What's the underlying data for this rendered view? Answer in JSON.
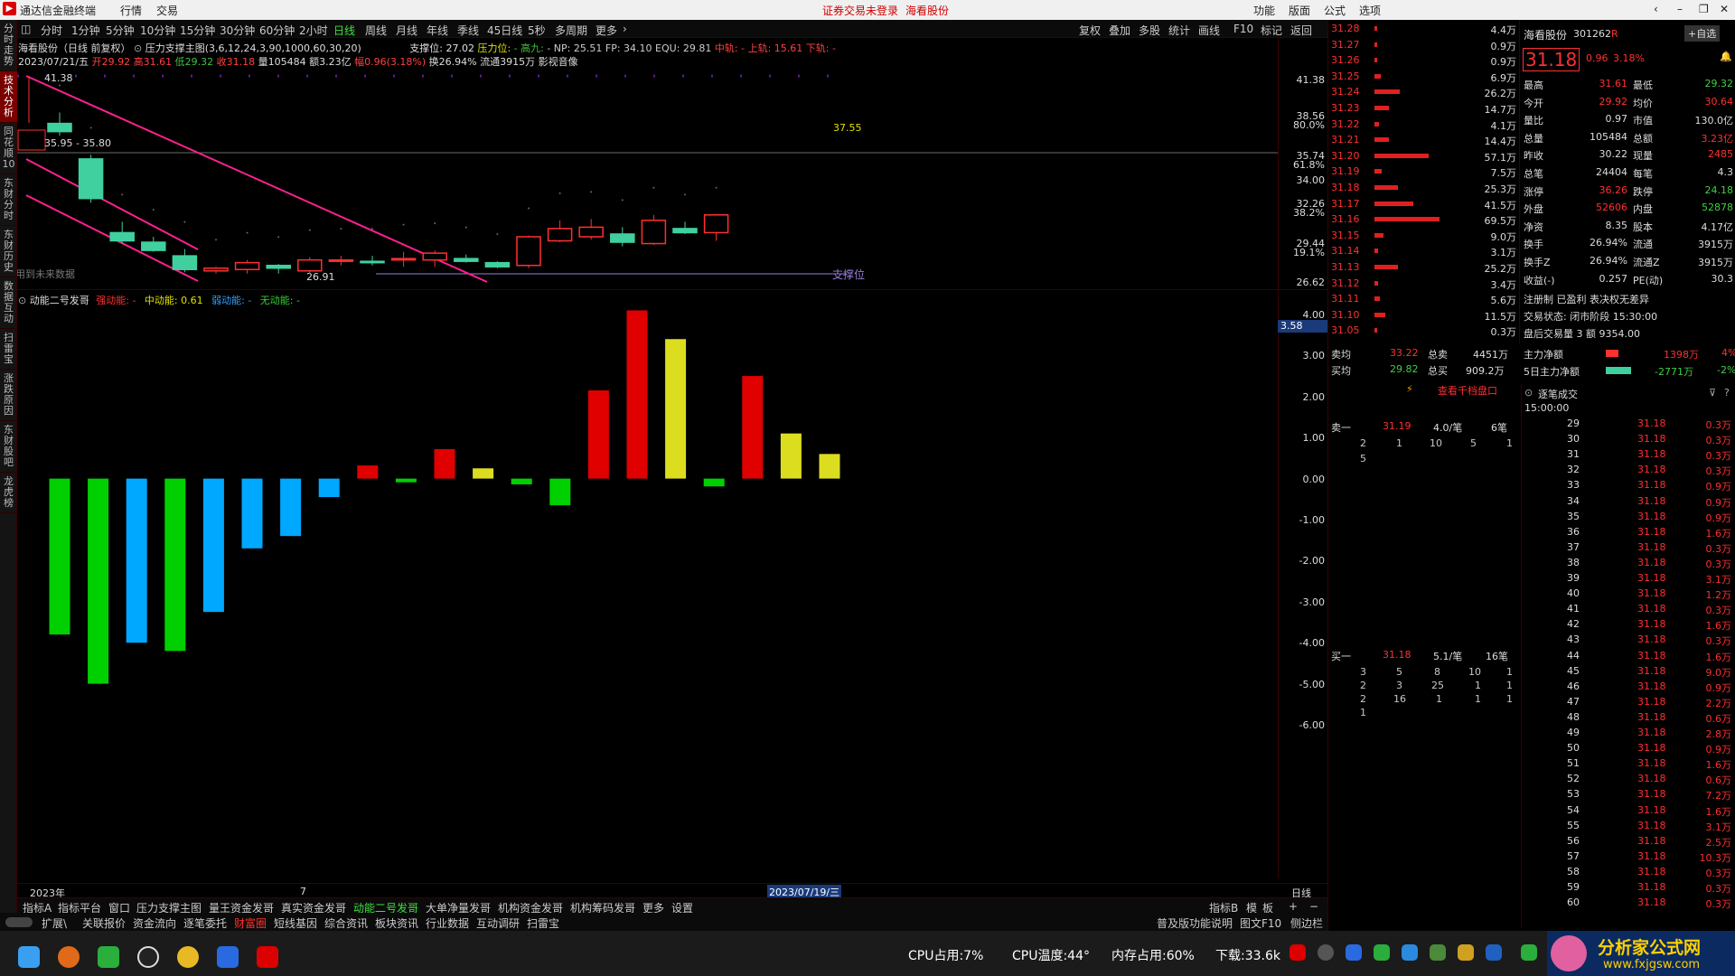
{
  "titlebar": {
    "app_name": "通达信金融终端",
    "menus": [
      "行情",
      "交易"
    ],
    "warning": "证券交易未登录",
    "stock": "海看股份",
    "right_menus": [
      "功能",
      "版面",
      "公式",
      "选项"
    ]
  },
  "left_nav": [
    "分时走势",
    "技术分析",
    "同花顺10",
    "东财分时",
    "东财历史",
    "数据互动",
    "扫雷宝",
    "涨跌原因",
    "东财股吧",
    "龙虎榜"
  ],
  "periods": [
    "分时",
    "1分钟",
    "5分钟",
    "10分钟",
    "15分钟",
    "30分钟",
    "60分钟",
    "2小时",
    "日线",
    "周线",
    "月线",
    "年线",
    "季线",
    "45日线",
    "5秒",
    "多周期",
    "更多"
  ],
  "toolbar": [
    "复权",
    "叠加",
    "多股",
    "统计",
    "画线",
    "F10",
    "标记",
    "返回"
  ],
  "header": {
    "line1_name": "海看股份（日线 前复权）",
    "line1_formula": "压力支撑主图(3,6,12,24,3,90,1000,60,30,20)",
    "line1_support_label": "支撑位: 27.02",
    "line1_pressure_label": "压力位:",
    "line1_gao": "- 高九:",
    "line1_np": "- NP: 25.51",
    "line1_fp": "FP: 34.10",
    "line1_equ": "EQU: 29.81",
    "line1_mid": "中轨:",
    "line1_up": "- 上轨: 15.61",
    "line1_down": "下轨: -",
    "line2_date": "2023/07/21/五",
    "line2_open": "开29.92",
    "line2_high": "高31.61",
    "line2_low": "低29.32",
    "line2_close": "收31.18",
    "line2_vol": "量105484",
    "line2_amt": "额3.23亿",
    "line2_chg": "幅0.96(3.18%)",
    "line2_turn": "换26.94%",
    "line2_float": "流通3915万",
    "line2_tail": "影视音像"
  },
  "kline_labels": {
    "top_price": "41.38",
    "range": "35.95 - 35.80",
    "mark": "37.55",
    "low_mark": "26.91",
    "support": "支撑位",
    "future_data": "用到未来数据"
  },
  "price_axis": [
    "41.38",
    "38.56",
    "80.0%",
    "35.74",
    "61.8%",
    "34.00",
    "32.26",
    "38.2%",
    "29.44",
    "19.1%",
    "26.62"
  ],
  "indicator": {
    "name": "动能二号发哥",
    "strong": "强动能: -",
    "mid": "中动能: 0.61",
    "weak": "弱动能: -",
    "none": "无动能: -",
    "axis": [
      "4.00",
      "3.00",
      "2.00",
      "1.00",
      "0.00",
      "-1.00",
      "-2.00",
      "-3.00",
      "-4.00",
      "-5.00",
      "-6.00"
    ],
    "axis_vals": [
      4,
      3,
      2,
      1,
      0,
      -1,
      -2,
      -3,
      -4,
      -5,
      -6
    ],
    "cursor_value": "3.58"
  },
  "chart_data": [
    {
      "type": "candlestick",
      "title": "海看股份（日线 前复权）",
      "candles": [
        {
          "o": 37.9,
          "h": 38.7,
          "l": 37.0,
          "c": 37.3
        },
        {
          "o": 35.3,
          "h": 35.6,
          "l": 32.1,
          "c": 32.4
        },
        {
          "o": 29.9,
          "h": 30.7,
          "l": 29.1,
          "c": 29.3
        },
        {
          "o": 29.2,
          "h": 29.6,
          "l": 28.5,
          "c": 28.6
        },
        {
          "o": 28.2,
          "h": 28.7,
          "l": 27.0,
          "c": 27.2
        },
        {
          "o": 27.1,
          "h": 27.4,
          "l": 26.9,
          "c": 27.3
        },
        {
          "o": 27.2,
          "h": 27.9,
          "l": 26.9,
          "c": 27.7
        },
        {
          "o": 27.5,
          "h": 27.6,
          "l": 26.9,
          "c": 27.3
        },
        {
          "o": 27.1,
          "h": 28.1,
          "l": 26.9,
          "c": 27.9
        },
        {
          "o": 27.8,
          "h": 28.2,
          "l": 27.5,
          "c": 27.9
        },
        {
          "o": 27.8,
          "h": 28.2,
          "l": 27.5,
          "c": 27.7
        },
        {
          "o": 27.9,
          "h": 28.5,
          "l": 27.4,
          "c": 28.0
        },
        {
          "o": 27.9,
          "h": 28.6,
          "l": 27.4,
          "c": 28.4
        },
        {
          "o": 28.0,
          "h": 28.3,
          "l": 27.7,
          "c": 27.8
        },
        {
          "o": 27.7,
          "h": 27.8,
          "l": 27.3,
          "c": 27.4
        },
        {
          "o": 27.5,
          "h": 29.7,
          "l": 27.3,
          "c": 29.6
        },
        {
          "o": 29.3,
          "h": 30.8,
          "l": 29.2,
          "c": 30.2
        },
        {
          "o": 29.6,
          "h": 30.9,
          "l": 29.4,
          "c": 30.3
        },
        {
          "o": 29.8,
          "h": 30.3,
          "l": 28.9,
          "c": 29.2
        },
        {
          "o": 29.1,
          "h": 31.2,
          "l": 29.0,
          "c": 30.8
        },
        {
          "o": 30.2,
          "h": 30.7,
          "l": 29.8,
          "c": 29.9
        },
        {
          "o": 29.9,
          "h": 31.2,
          "l": 29.3,
          "c": 31.2
        }
      ]
    },
    {
      "type": "bar",
      "title": "动能二号发哥",
      "values": [
        -3.8,
        -5.0,
        -4.0,
        -4.2,
        -3.25,
        -1.7,
        -1.4,
        -0.45,
        0.32,
        -0.09,
        0.72,
        0.25,
        -0.14,
        -0.65,
        2.15,
        4.1,
        3.4,
        -0.19,
        2.5,
        1.1,
        0.6
      ],
      "colors": [
        "#00d000",
        "#00d000",
        "#00a8ff",
        "#00d000",
        "#00a8ff",
        "#00a8ff",
        "#00a8ff",
        "#00a8ff",
        "#e00000",
        "#00d000",
        "#e00000",
        "#dddd20",
        "#00d000",
        "#00d000",
        "#e00000",
        "#e00000",
        "#dddd20",
        "#00d000",
        "#e00000",
        "#dddd20",
        "#dddd20"
      ],
      "ylim": [
        -6,
        4
      ]
    }
  ],
  "bottom_labels": {
    "x_year": "2023年",
    "x_month": "7",
    "x_cursor": "2023/07/19/三",
    "period_label": "日线"
  },
  "formula_tabs": [
    "指标A",
    "指标平台",
    "窗口",
    "压力支撑主图",
    "量王资金发哥",
    "真实资金发哥",
    "动能二号发哥",
    "大单净量发哥",
    "机构资金发哥",
    "机构筹码发哥",
    "更多",
    "设置"
  ],
  "formula_tabs_right": [
    "指标B",
    "模",
    "板",
    "+",
    "−"
  ],
  "bottom_tabs": [
    "扩展\\",
    "关联报价",
    "资金流向",
    "逐笔委托",
    "财富圈",
    "短线基因",
    "综合资讯",
    "板块资讯",
    "行业数据",
    "互动调研",
    "扫雷宝"
  ],
  "bottom_tabs_right": [
    "普及版功能说明",
    "图文F10",
    "侧边栏",
    "队列",
    "分布",
    "龙虎",
    "笔",
    "价",
    "细",
    "势",
    "联",
    "值",
    "主",
    "筹"
  ],
  "ladder": {
    "rows": [
      {
        "p": "31.28",
        "v": "4.4万",
        "w": 0.02
      },
      {
        "p": "31.27",
        "v": "0.9万",
        "w": 0.01
      },
      {
        "p": "31.26",
        "v": "0.9万",
        "w": 0.01
      },
      {
        "p": "31.25",
        "v": "6.9万",
        "w": 0.06
      },
      {
        "p": "31.24",
        "v": "26.2万",
        "w": 0.23
      },
      {
        "p": "31.23",
        "v": "14.7万",
        "w": 0.13
      },
      {
        "p": "31.22",
        "v": "4.1万",
        "w": 0.04
      },
      {
        "p": "31.21",
        "v": "14.4万",
        "w": 0.13
      },
      {
        "p": "31.20",
        "v": "57.1万",
        "w": 0.5
      },
      {
        "p": "31.19",
        "v": "7.5万",
        "w": 0.07
      },
      {
        "p": "31.18",
        "v": "25.3万",
        "w": 0.22
      },
      {
        "p": "31.17",
        "v": "41.5万",
        "w": 0.36
      },
      {
        "p": "31.16",
        "v": "69.5万",
        "w": 0.6
      },
      {
        "p": "31.15",
        "v": "9.0万",
        "w": 0.08
      },
      {
        "p": "31.14",
        "v": "3.1万",
        "w": 0.03
      },
      {
        "p": "31.13",
        "v": "25.2万",
        "w": 0.22
      },
      {
        "p": "31.12",
        "v": "3.4万",
        "w": 0.03
      },
      {
        "p": "31.11",
        "v": "5.6万",
        "w": 0.05
      },
      {
        "p": "31.10",
        "v": "11.5万",
        "w": 0.1
      },
      {
        "p": "31.05",
        "v": "0.3万",
        "w": 0.01
      }
    ]
  },
  "quote": {
    "name": "海看股份",
    "code": "301262",
    "flag": "R",
    "watch": "+自选",
    "price": "31.18",
    "change": "0.96",
    "pct": "3.18%",
    "rows": [
      [
        "最高",
        "31.61",
        "最低",
        "29.32"
      ],
      [
        "今开",
        "29.92",
        "均价",
        "30.64"
      ],
      [
        "量比",
        "0.97",
        "市值",
        "130.0亿"
      ],
      [
        "总量",
        "105484",
        "总额",
        "3.23亿"
      ],
      [
        "昨收",
        "30.22",
        "现量",
        "2485"
      ],
      [
        "总笔",
        "24404",
        "每笔",
        "4.3"
      ],
      [
        "涨停",
        "36.26",
        "跌停",
        "24.18"
      ],
      [
        "外盘",
        "52606",
        "内盘",
        "52878"
      ],
      [
        "净资",
        "8.35",
        "股本",
        "4.17亿"
      ],
      [
        "换手",
        "26.94%",
        "流通",
        "3915万"
      ],
      [
        "换手Z",
        "26.94%",
        "流通Z",
        "3915万"
      ],
      [
        "收益(-)",
        "0.257",
        "PE(动)",
        "30.3"
      ]
    ],
    "status1": "注册制  已盈利  表决权无差异",
    "status2": "交易状态: 闭市阶段  15:30:00",
    "status3": "盘后交易量 3  额 9354.00",
    "main_net": "1398万",
    "main_net_pct": "4%",
    "main_net_label": "主力净额",
    "main5_net": "-2771万",
    "main5_net_pct": "-2%",
    "main5_net_label": "5日主力净额"
  },
  "orderbook": {
    "sell_avg_label": "卖均",
    "sell_avg": "33.22",
    "sell_total_label": "总卖",
    "sell_total": "4451万",
    "buy_avg_label": "买均",
    "buy_avg": "29.82",
    "buy_total_label": "总买",
    "buy_total": "909.2万",
    "view_btn": "查看千档盘口",
    "sell1_label": "卖一",
    "sell1_price": "31.19",
    "sell1_avg": "4.0/笔",
    "sell1_count": "6笔",
    "sell1_q1": [
      "2",
      "1",
      "10",
      "5",
      "1"
    ],
    "sell1_q2": [
      "5"
    ],
    "buy1_label": "买一",
    "buy1_price": "31.18",
    "buy1_avg": "5.1/笔",
    "buy1_count": "16笔",
    "buy1_q1": [
      "3",
      "5",
      "8",
      "10",
      "1"
    ],
    "buy1_q2": [
      "2",
      "3",
      "25",
      "1",
      "1"
    ],
    "buy1_q3": [
      "2",
      "16",
      "1",
      "1",
      "1"
    ],
    "buy1_q4": [
      "1"
    ]
  },
  "ticks": {
    "title": "逐笔成交",
    "time": "15:00:00",
    "rows": [
      [
        "29",
        "31.18",
        "0.3万"
      ],
      [
        "30",
        "31.18",
        "0.3万"
      ],
      [
        "31",
        "31.18",
        "0.3万"
      ],
      [
        "32",
        "31.18",
        "0.3万"
      ],
      [
        "33",
        "31.18",
        "0.9万"
      ],
      [
        "34",
        "31.18",
        "0.9万"
      ],
      [
        "35",
        "31.18",
        "0.9万"
      ],
      [
        "36",
        "31.18",
        "1.6万"
      ],
      [
        "37",
        "31.18",
        "0.3万"
      ],
      [
        "38",
        "31.18",
        "0.3万"
      ],
      [
        "39",
        "31.18",
        "3.1万"
      ],
      [
        "40",
        "31.18",
        "1.2万"
      ],
      [
        "41",
        "31.18",
        "0.3万"
      ],
      [
        "42",
        "31.18",
        "1.6万"
      ],
      [
        "43",
        "31.18",
        "0.3万"
      ],
      [
        "44",
        "31.18",
        "1.6万"
      ],
      [
        "45",
        "31.18",
        "9.0万"
      ],
      [
        "46",
        "31.18",
        "0.9万"
      ],
      [
        "47",
        "31.18",
        "2.2万"
      ],
      [
        "48",
        "31.18",
        "0.6万"
      ],
      [
        "49",
        "31.18",
        "2.8万"
      ],
      [
        "50",
        "31.18",
        "0.9万"
      ],
      [
        "51",
        "31.18",
        "1.6万"
      ],
      [
        "52",
        "31.18",
        "0.6万"
      ],
      [
        "53",
        "31.18",
        "7.2万"
      ],
      [
        "54",
        "31.18",
        "1.6万"
      ],
      [
        "55",
        "31.18",
        "3.1万"
      ],
      [
        "56",
        "31.18",
        "2.5万"
      ],
      [
        "57",
        "31.18",
        "10.3万"
      ],
      [
        "58",
        "31.18",
        "0.3万"
      ],
      [
        "59",
        "31.18",
        "0.3万"
      ],
      [
        "60",
        "31.18",
        "0.3万"
      ]
    ]
  },
  "taskbar": {
    "cpu": "CPU占用:7%",
    "temp": "CPU温度:44°",
    "mem": "内存占用:60%",
    "down": "下载:33.6k",
    "brand": "分析家公式网",
    "brand_url": "www.fxjgsw.com"
  }
}
